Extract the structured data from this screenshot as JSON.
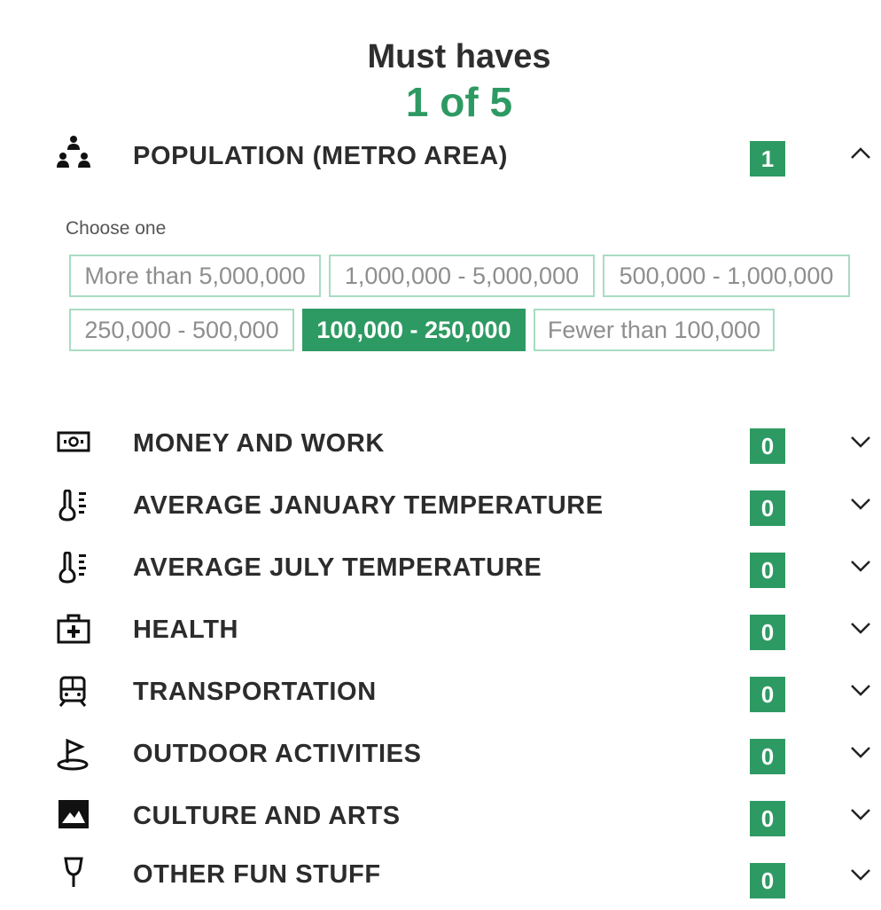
{
  "header": {
    "title": "Must haves",
    "progress": "1 of 5"
  },
  "population": {
    "label": "POPULATION (METRO AREA)",
    "count": "1",
    "icon": "population-icon",
    "expanded": true,
    "choose_label": "Choose one",
    "options": [
      "More than 5,000,000",
      "1,000,000 - 5,000,000",
      "500,000 - 1,000,000",
      "250,000 - 500,000",
      "100,000 - 250,000",
      "Fewer than 100,000"
    ],
    "selected_option": "100,000 - 250,000"
  },
  "categories": [
    {
      "label": "MONEY AND WORK",
      "count": "0",
      "icon": "money-icon"
    },
    {
      "label": "AVERAGE JANUARY TEMPERATURE",
      "count": "0",
      "icon": "thermometer-icon"
    },
    {
      "label": "AVERAGE JULY TEMPERATURE",
      "count": "0",
      "icon": "thermometer-icon"
    },
    {
      "label": "HEALTH",
      "count": "0",
      "icon": "first-aid-kit-icon"
    },
    {
      "label": "TRANSPORTATION",
      "count": "0",
      "icon": "train-icon"
    },
    {
      "label": "OUTDOOR ACTIVITIES",
      "count": "0",
      "icon": "golf-flag-icon"
    },
    {
      "label": "CULTURE AND ARTS",
      "count": "0",
      "icon": "picture-icon"
    },
    {
      "label": "OTHER FUN STUFF",
      "count": "0",
      "icon": "wine-glass-icon"
    }
  ],
  "colors": {
    "accent": "#2e9a63",
    "option_border": "#a8dcc2",
    "text": "#2c2c2c"
  }
}
